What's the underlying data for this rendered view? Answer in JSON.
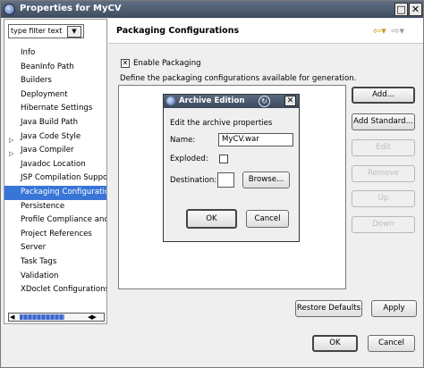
{
  "window": {
    "title": "Properties for MyCV",
    "minimize_glyph": "□",
    "close_glyph": "✕"
  },
  "left_pane": {
    "filter_text": "type filter text",
    "filter_button_icon": "chevron-down-icon",
    "items": [
      {
        "label": "Info",
        "expandable": false,
        "selected": false
      },
      {
        "label": "BeanInfo Path",
        "expandable": false,
        "selected": false
      },
      {
        "label": "Builders",
        "expandable": false,
        "selected": false
      },
      {
        "label": "Deployment",
        "expandable": false,
        "selected": false
      },
      {
        "label": "Hibernate Settings",
        "expandable": false,
        "selected": false
      },
      {
        "label": "Java Build Path",
        "expandable": false,
        "selected": false
      },
      {
        "label": "Java Code Style",
        "expandable": true,
        "selected": false
      },
      {
        "label": "Java Compiler",
        "expandable": true,
        "selected": false
      },
      {
        "label": "Javadoc Location",
        "expandable": false,
        "selected": false
      },
      {
        "label": "JSP Compilation Suppor",
        "expandable": false,
        "selected": false
      },
      {
        "label": "Packaging Configuratio",
        "expandable": false,
        "selected": true
      },
      {
        "label": "Persistence",
        "expandable": false,
        "selected": false
      },
      {
        "label": "Profile Compliance and",
        "expandable": false,
        "selected": false
      },
      {
        "label": "Project References",
        "expandable": false,
        "selected": false
      },
      {
        "label": "Server",
        "expandable": false,
        "selected": false
      },
      {
        "label": "Task Tags",
        "expandable": false,
        "selected": false
      },
      {
        "label": "Validation",
        "expandable": false,
        "selected": false
      },
      {
        "label": "XDoclet Configurations",
        "expandable": false,
        "selected": false
      }
    ]
  },
  "page": {
    "title": "Packaging Configurations",
    "enable_packaging_label": "Enable Packaging",
    "enable_packaging_checked": true,
    "description": "Define the packaging configurations available for generation.",
    "buttons": {
      "add": "Add...",
      "add_standard": "Add Standard...",
      "edit": "Edit",
      "remove": "Remove",
      "up": "Up",
      "down": "Down"
    },
    "restore_defaults": "Restore Defaults",
    "apply": "Apply"
  },
  "footer": {
    "ok": "OK",
    "cancel": "Cancel"
  },
  "dialog": {
    "title": "Archive Edition",
    "heading": "Edit the archive properties",
    "name_label": "Name:",
    "name_value": "MyCV.war",
    "exploded_label": "Exploded:",
    "exploded_checked": false,
    "destination_label": "Destination:",
    "destination_value": "",
    "browse": "Browse...",
    "ok": "OK",
    "cancel": "Cancel"
  },
  "colors": {
    "selection": "#3875d7",
    "titlebar": "#4a576a",
    "disabled_text": "#bdbdbd"
  }
}
